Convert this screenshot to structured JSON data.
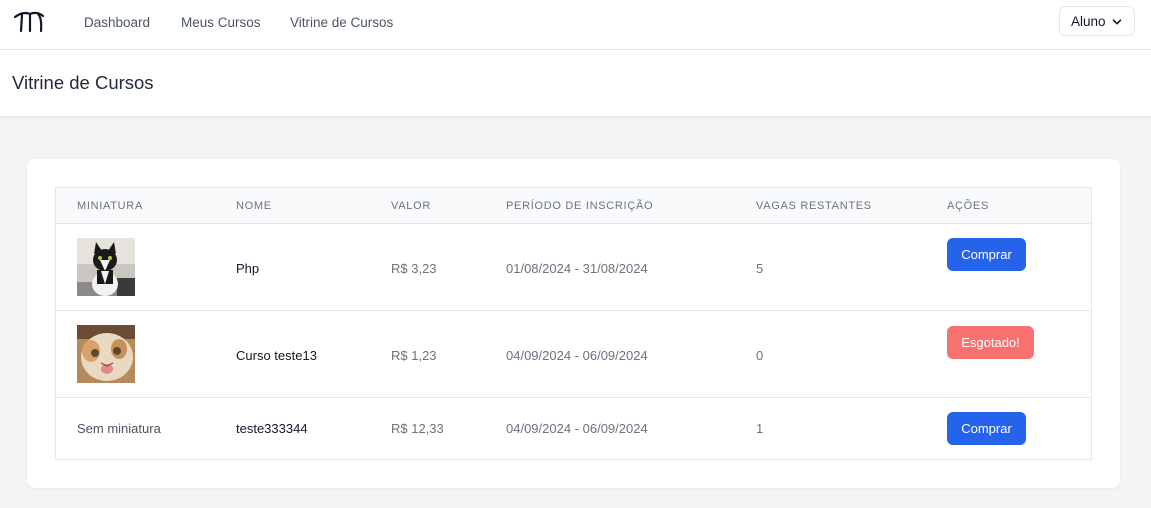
{
  "nav": {
    "links": [
      {
        "label": "Dashboard"
      },
      {
        "label": "Meus Cursos"
      },
      {
        "label": "Vitrine de Cursos"
      }
    ],
    "role_select": {
      "value": "Aluno"
    }
  },
  "page": {
    "title": "Vitrine de Cursos"
  },
  "table": {
    "columns": [
      "MINIATURA",
      "NOME",
      "VALOR",
      "PERÍODO DE INSCRIÇÃO",
      "VAGAS RESTANTES",
      "AÇÕES"
    ],
    "rows": [
      {
        "thumbnail": "cat-photo-black-white",
        "name": "Php",
        "price": "R$ 3,23",
        "period": "01/08/2024 - 31/08/2024",
        "slots": "5",
        "action": "Comprar"
      },
      {
        "thumbnail": "cat-photo-orange",
        "name": "Curso teste13",
        "price": "R$ 1,23",
        "period": "04/09/2024 - 06/09/2024",
        "slots": "0",
        "action": "Esgotado!"
      },
      {
        "thumbnail_text": "Sem miniatura",
        "name": "teste333344",
        "price": "R$ 12,33",
        "period": "04/09/2024 - 06/09/2024",
        "slots": "1",
        "action": "Comprar"
      }
    ]
  },
  "colors": {
    "buy_button": "#2563eb",
    "soldout_button": "#f87171"
  }
}
